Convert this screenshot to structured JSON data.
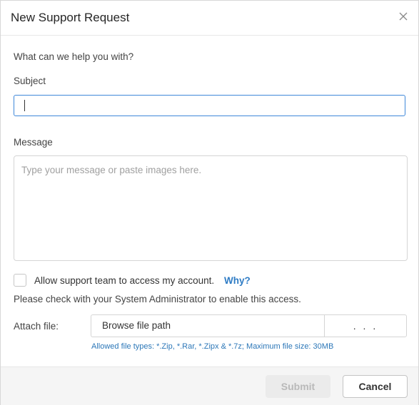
{
  "dialog": {
    "title": "New Support Request",
    "close_icon": "close-icon"
  },
  "form": {
    "help_text": "What can we help you with?",
    "subject_label": "Subject",
    "subject_value": "",
    "message_label": "Message",
    "message_placeholder": "Type your message or paste images here.",
    "access_checkbox_label": "Allow support team to access my account.",
    "access_checked": false,
    "why_link": "Why?",
    "admin_note": "Please check with your System Administrator to enable this access.",
    "attach_label": "Attach file:",
    "file_path_placeholder": "Browse file path",
    "browse_button": ". . .",
    "file_hint": "Allowed file types: *.Zip, *.Rar, *.Zipx & *.7z; Maximum file size: 30MB"
  },
  "footer": {
    "submit_label": "Submit",
    "cancel_label": "Cancel"
  },
  "colors": {
    "accent": "#3f88d9",
    "link": "#2f7cc5",
    "hint": "#2c77b8",
    "disabled_text": "#b9b9b9"
  }
}
